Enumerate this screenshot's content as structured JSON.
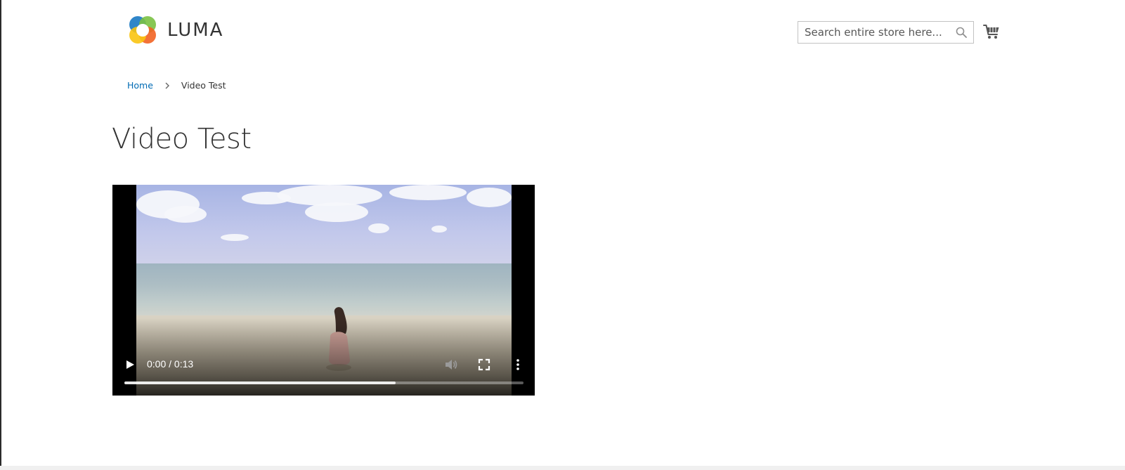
{
  "header": {
    "logo_text": "LUMA",
    "search": {
      "placeholder": "Search entire store here...",
      "value": ""
    }
  },
  "icons": {
    "logo": "luma-logo-icon",
    "search": "search-icon",
    "cart": "shopping-cart-icon",
    "breadcrumb_separator": "chevron-right-icon",
    "play": "play-icon",
    "volume": "volume-icon",
    "fullscreen": "fullscreen-icon",
    "more": "more-options-icon"
  },
  "breadcrumb": {
    "home": "Home",
    "current": "Video Test"
  },
  "page": {
    "title": "Video Test"
  },
  "video": {
    "time": "0:00 / 0:13",
    "buffered_fraction": 0.68
  },
  "colors": {
    "link": "#006bb4",
    "text": "#333333",
    "search_border": "#c2c2c2"
  }
}
